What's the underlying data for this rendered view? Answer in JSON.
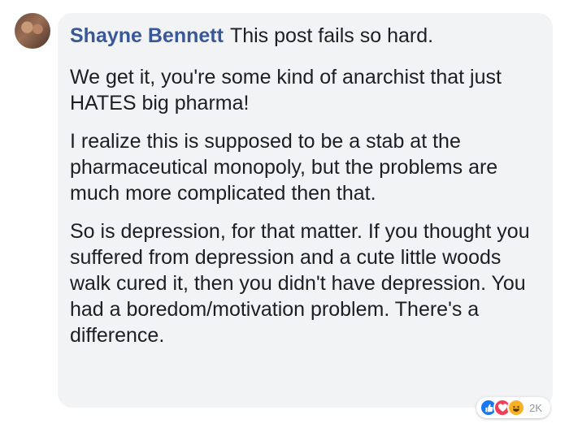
{
  "comment": {
    "author": "Shayne Bennett",
    "first_line": "This post fails so hard.",
    "paragraphs": [
      "We get it, you're some kind of anarchist that just HATES big pharma!",
      "I realize this is supposed to be a stab at the pharmaceutical monopoly, but the problems are much more complicated then that.",
      "So is depression, for that matter. If you thought you suffered from depression and a cute little woods walk cured it, then you didn't have depression. You had a boredom/motivation problem. There's a difference."
    ]
  },
  "reactions": {
    "icons": [
      "like-icon",
      "love-icon",
      "haha-icon"
    ],
    "colors": {
      "like": "#1877f2",
      "love": "#f33e58",
      "haha": "#f7b125"
    },
    "count": "2K"
  },
  "colors": {
    "author": "#385898",
    "bubble": "#f2f3f5",
    "text": "#1c1e21"
  }
}
